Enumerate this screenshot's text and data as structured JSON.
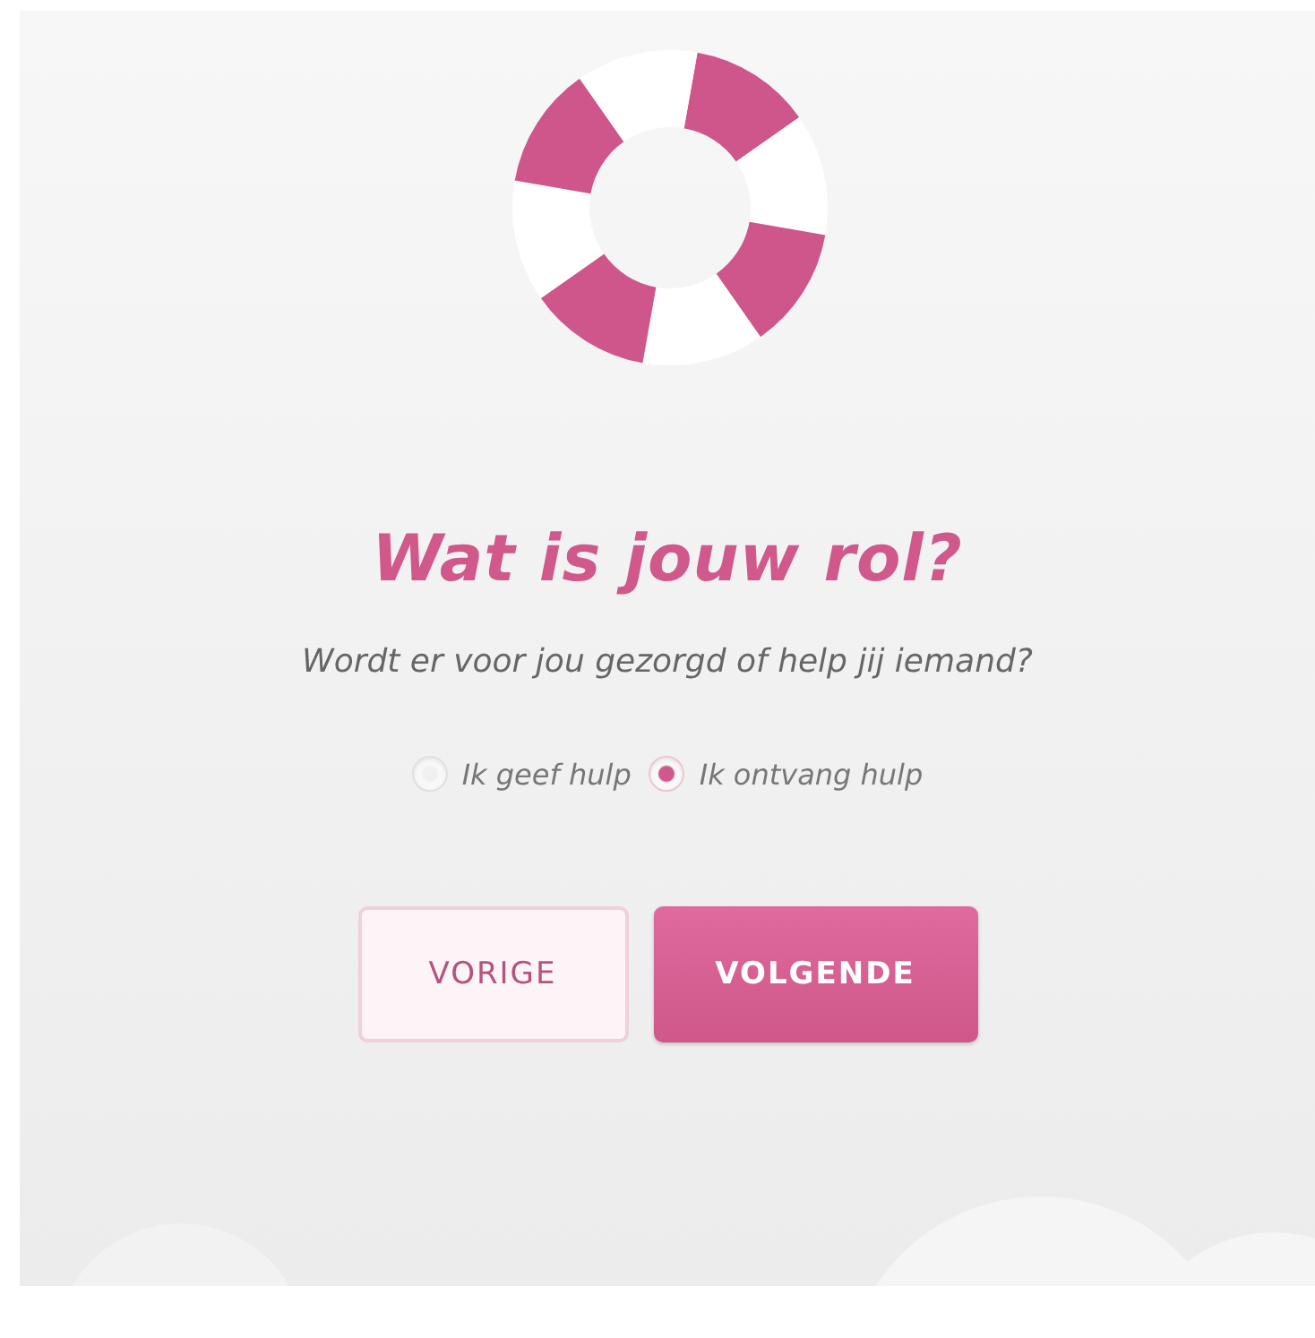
{
  "title": "Wat is jouw rol?",
  "question": "Wordt er voor jou gezorgd of help jij iemand?",
  "options": [
    {
      "label": "Ik geef hulp",
      "selected": false
    },
    {
      "label": "Ik ontvang hulp",
      "selected": true
    }
  ],
  "buttons": [
    {
      "label": "VORIGE",
      "kind": "secondary"
    },
    {
      "label": "VOLGENDE",
      "kind": "primary"
    }
  ]
}
